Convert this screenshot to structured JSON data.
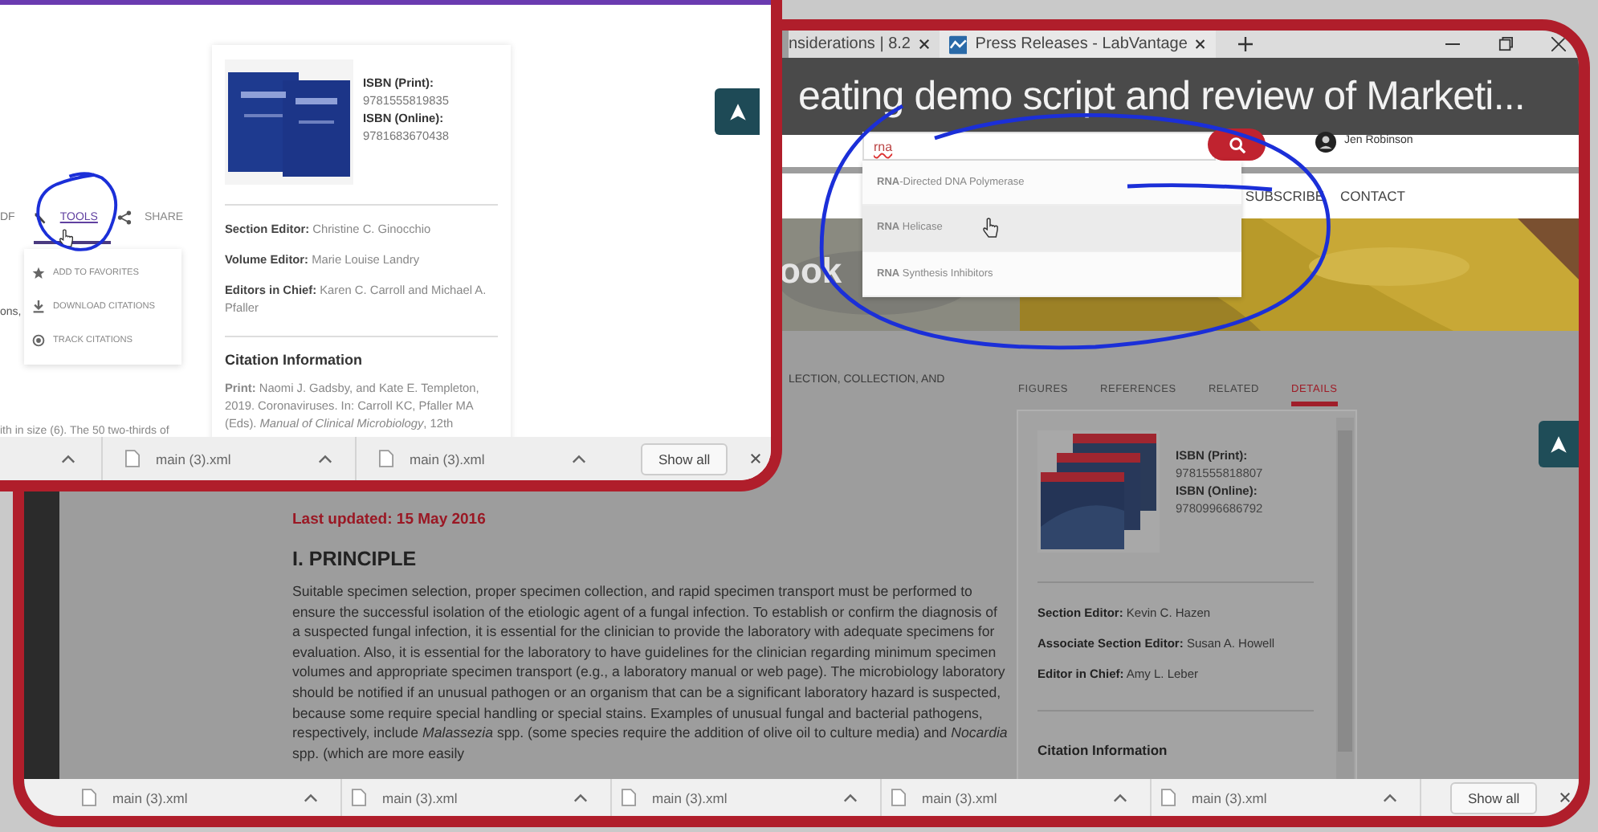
{
  "inset_window": {
    "tools_bar": {
      "cut_label": "DF",
      "tools": "TOOLS",
      "share": "SHARE"
    },
    "tools_menu": [
      {
        "kind": "favorite",
        "label": "ADD TO FAVORITES"
      },
      {
        "kind": "download",
        "label": "DOWNLOAD CITATIONS"
      },
      {
        "kind": "track",
        "label": "TRACK CITATIONS"
      }
    ],
    "body_fragments": [
      "ons,",
      "ith in size (6). The 50 two-thirds of"
    ],
    "details": {
      "isbn": [
        {
          "label": "ISBN (Print):",
          "value": "9781555819835"
        },
        {
          "label": "ISBN (Online):",
          "value": "9781683670438"
        }
      ],
      "editors": [
        {
          "label": "Section Editor:",
          "value": "Christine C. Ginocchio"
        },
        {
          "label": "Volume Editor:",
          "value": "Marie Louise Landry"
        },
        {
          "label": "Editors in Chief:",
          "value": "Karen C. Carroll and Michael A. Pfaller"
        }
      ],
      "citation_heading": "Citation Information",
      "citation": "**Print:** Naomi J. Gadsby, and Kate E. Templeton, 2019. Coronaviruses. In: Carroll KC, Pfaller MA (Eds). *Manual of Clinical Microbiology*, 12th"
    },
    "downloads": [
      {
        "name": "main (3).xml"
      },
      {
        "name": "main (3).xml"
      }
    ],
    "show_all": "Show all"
  },
  "main_window": {
    "tabs": [
      {
        "title": "nsiderations | 8.2"
      },
      {
        "title": "Press Releases - LabVantage"
      }
    ],
    "video_title": "eating demo script and review of Marketi...",
    "search": {
      "value": "rna"
    },
    "user": "Jen Robinson",
    "suggestions": [
      {
        "text": "**RNA**-Directed DNA Polymerase",
        "selected": false
      },
      {
        "text": "**RNA** Helicase",
        "selected": true
      },
      {
        "text": "**RNA** Synthesis Inhibitors",
        "selected": false
      }
    ],
    "nav": [
      "SUBSCRIBE",
      "CONTACT"
    ],
    "hero_title": "ook",
    "breadcrumb": "LECTION, COLLECTION, AND",
    "article": {
      "last_updated": "Last updated: 15 May 2016",
      "heading": "I. PRINCIPLE",
      "paragraph": "Suitable specimen selection, proper specimen collection, and rapid specimen transport must be performed to ensure the successful isolation of the etiologic agent of a fungal infection. To establish or confirm the diagnosis of a suspected fungal infection, it is essential for the clinician to provide the laboratory with adequate specimens for evaluation. Also, it is essential for the laboratory to have guidelines for the clinician regarding minimum specimen volumes and appropriate specimen transport (e.g., a laboratory manual or web page). The microbiology laboratory should be notified if an unusual pathogen or an organism that can be a significant laboratory hazard is suspected, because some require special handling or special stains. Examples of unusual fungal and bacterial pathogens, respectively, include *Malassezia* spp. (some species require the addition of olive oil to culture media) and *Nocardia* spp. (which are more easily"
    },
    "detail_tabs": [
      {
        "label": "FIGURES",
        "selected": false
      },
      {
        "label": "REFERENCES",
        "selected": false
      },
      {
        "label": "RELATED",
        "selected": false
      },
      {
        "label": "DETAILS",
        "selected": true
      }
    ],
    "details": {
      "isbn": [
        {
          "label": "ISBN (Print):",
          "value": "9781555818807"
        },
        {
          "label": "ISBN (Online):",
          "value": "9780996686792"
        }
      ],
      "editors": [
        {
          "label": "Section Editor:",
          "value": "Kevin C. Hazen"
        },
        {
          "label": "Associate Section Editor:",
          "value": "Susan A. Howell"
        },
        {
          "label": "Editor in Chief:",
          "value": "Amy L. Leber"
        }
      ],
      "citation_heading": "Citation Information"
    },
    "downloads": [
      {
        "name": "main (3).xml"
      },
      {
        "name": "main (3).xml"
      },
      {
        "name": "main (3).xml"
      },
      {
        "name": "main (3).xml"
      },
      {
        "name": "main (3).xml"
      }
    ],
    "show_all": "Show all"
  }
}
